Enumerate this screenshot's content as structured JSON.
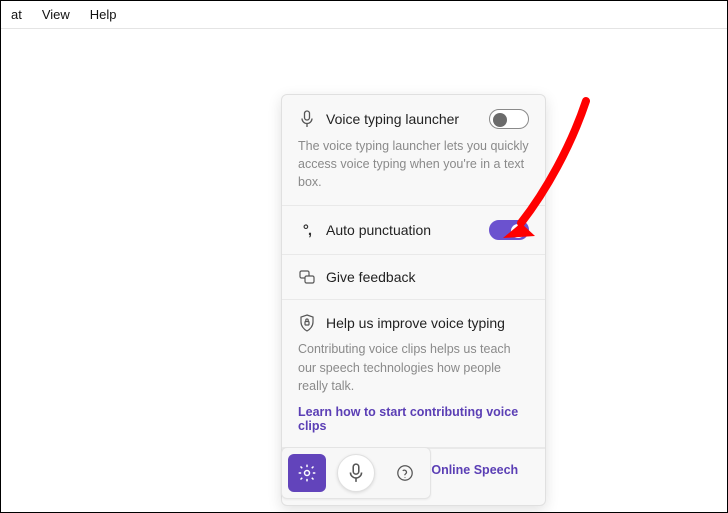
{
  "menubar": {
    "items": [
      "at",
      "View",
      "Help"
    ]
  },
  "panel": {
    "launcher": {
      "label": "Voice typing launcher",
      "desc": "The voice typing launcher lets you quickly access voice typing when you're in a text box.",
      "enabled": false
    },
    "punctuation": {
      "label": "Auto punctuation",
      "enabled": true
    },
    "feedback": {
      "label": "Give feedback"
    },
    "improve": {
      "label": "Help us improve voice typing",
      "desc": "Contributing voice clips helps us teach our speech technologies how people really talk.",
      "link": "Learn how to start contributing voice clips"
    },
    "footer": "Powered by Microsoft Online Speech Tech"
  },
  "colors": {
    "accent": "#6b52cf",
    "annotation": "#ff0000"
  }
}
